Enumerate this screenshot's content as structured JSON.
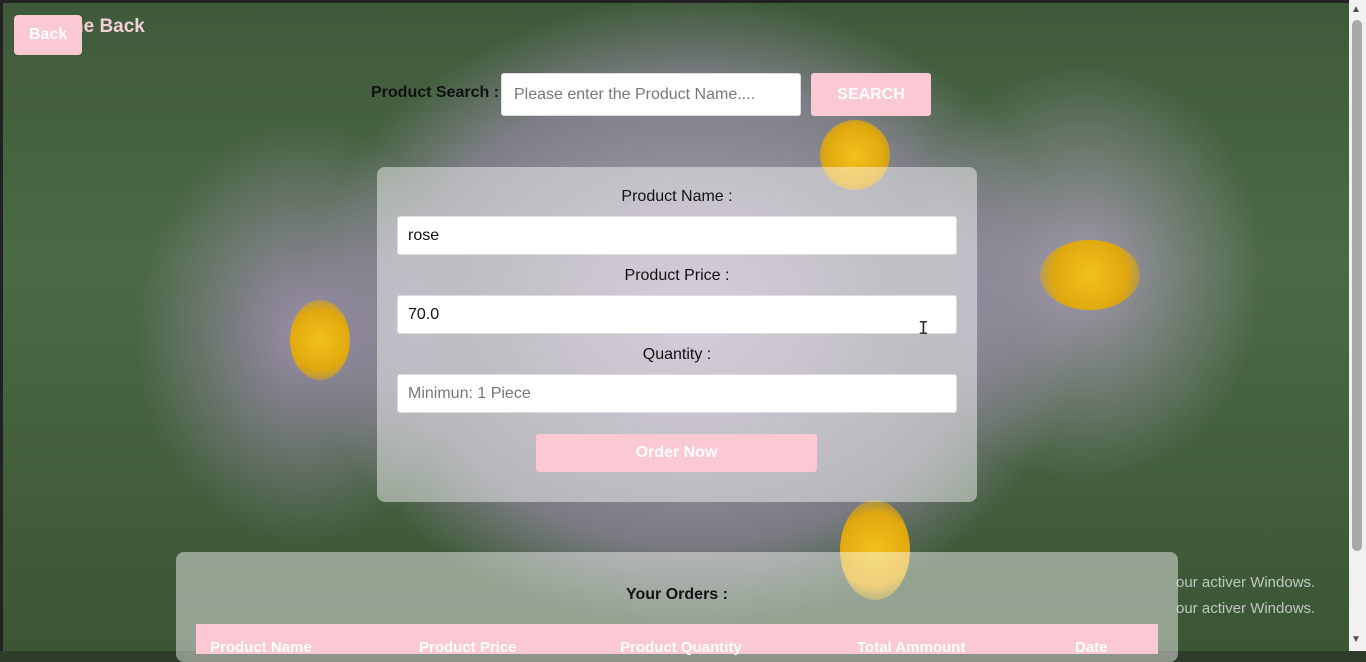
{
  "header": {
    "welcome_text": "ne Back",
    "back_label": "Back"
  },
  "search": {
    "label": "Product Search :",
    "placeholder": "Please enter the Product Name....",
    "button_label": "SEARCH"
  },
  "order_form": {
    "product_name_label": "Product Name :",
    "product_name_value": "rose",
    "product_price_label": "Product Price :",
    "product_price_value": "70.0",
    "quantity_label": "Quantity :",
    "quantity_placeholder": "Minimun: 1 Piece",
    "order_button_label": "Order Now"
  },
  "orders": {
    "title": "Your Orders :",
    "columns": [
      "Product Name",
      "Product Price",
      "Product Quantity",
      "Total Ammount",
      "Date"
    ]
  },
  "watermark": {
    "line1": "our activer Windows.",
    "line2": "our activer Windows."
  },
  "colors": {
    "accent_pink": "#fbc9d4"
  }
}
